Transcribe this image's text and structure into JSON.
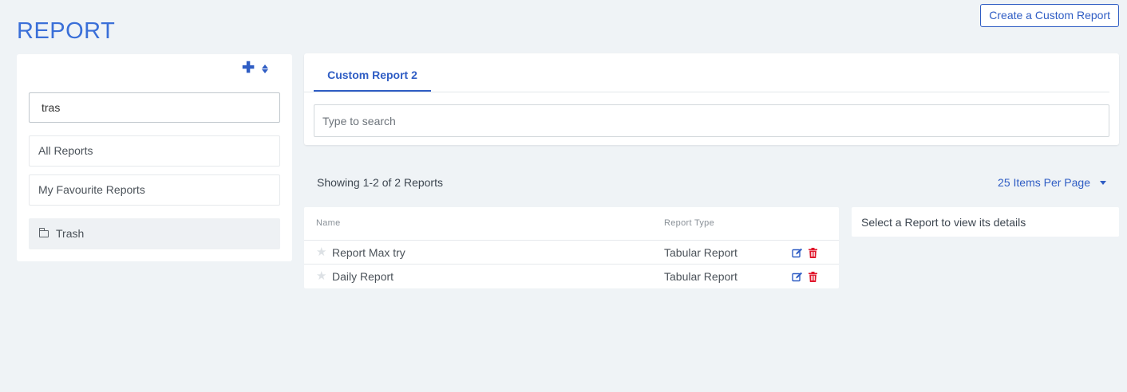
{
  "header": {
    "title": "REPORT",
    "create_button": "Create a Custom Report"
  },
  "sidebar": {
    "search_value": "tras",
    "items": [
      {
        "label": "All Reports"
      },
      {
        "label": "My Favourite Reports"
      },
      {
        "label": "Trash",
        "icon": "folder-icon",
        "selected": true
      }
    ],
    "tools": [
      "plus-icon",
      "sort-icon"
    ]
  },
  "main": {
    "tabs": [
      {
        "label": "Custom Report 2",
        "active": true
      }
    ],
    "search_placeholder": "Type to search"
  },
  "listing": {
    "summary": "Showing 1-2 of 2 Reports",
    "per_page": "25 Items Per Page"
  },
  "table": {
    "columns": [
      "Name",
      "Report Type"
    ],
    "rows": [
      {
        "name": "Report Max try",
        "type": "Tabular Report"
      },
      {
        "name": "Daily Report",
        "type": "Tabular Report"
      }
    ]
  },
  "details": {
    "message": "Select a Report to view its details"
  },
  "colors": {
    "accent": "#2f5dc4",
    "title": "#3a6fd8",
    "danger": "#e0162b",
    "background": "#eff3f6"
  }
}
